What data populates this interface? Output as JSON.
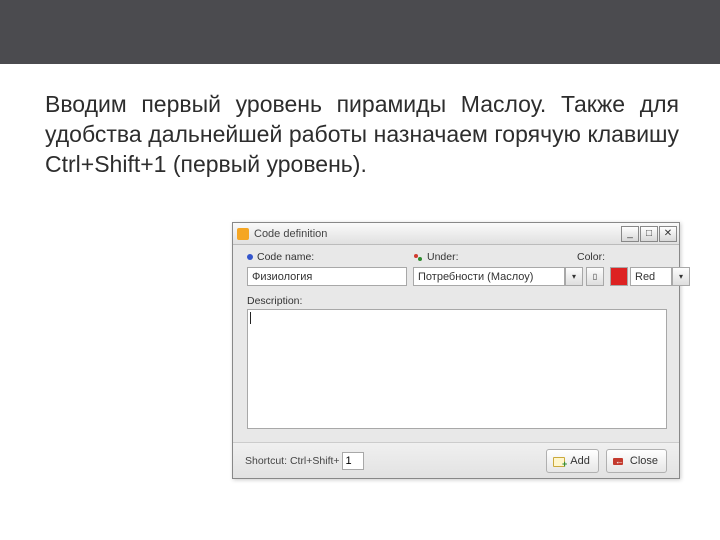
{
  "intro": "Вводим первый уровень пирамиды Маслоу. Также для удобства дальнейшей работы назначаем горячую клавишу Ctrl+Shift+1 (первый уровень).",
  "dialog": {
    "title": "Code definition",
    "labels": {
      "code_name": "Code name:",
      "under": "Under:",
      "color": "Color:",
      "description": "Description:"
    },
    "values": {
      "code_name": "Физиология",
      "under": "Потребности (Маслоу)",
      "color": "Red",
      "description": ""
    },
    "shortcut": {
      "label": "Shortcut: Ctrl+Shift+",
      "value": "1"
    },
    "buttons": {
      "add": "Add",
      "close": "Close"
    },
    "winbtns": {
      "min": "_",
      "max": "□",
      "close": "✕"
    },
    "dropdown_arrow": "▾",
    "picker": "▯"
  }
}
